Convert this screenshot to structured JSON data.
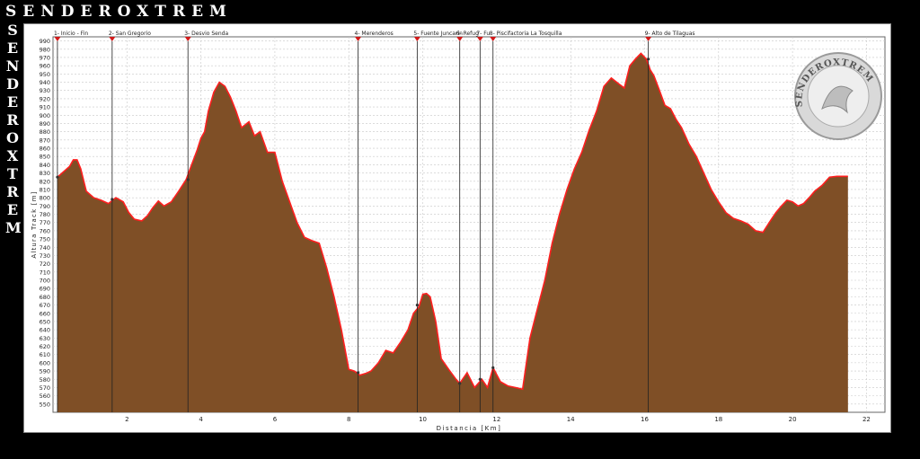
{
  "brand": {
    "title": "SENDEROXTREM",
    "vertical": [
      "S",
      "E",
      "N",
      "D",
      "E",
      "R",
      "O",
      "X",
      "T",
      "R",
      "E",
      "M"
    ],
    "logo_text": "SENDEROXTREM"
  },
  "colors": {
    "fill": "#7f4f26",
    "line": "#ff1f1f",
    "waypoint_line": "#222222",
    "waypoint_marker": "#d11a1a",
    "grid": "#c8c8c8",
    "panel": "#ffffff",
    "background": "#000000"
  },
  "chart_data": {
    "type": "area",
    "title": "",
    "xlabel": "Distancia [Km]",
    "ylabel": "Altura Track [m]",
    "xlim": [
      0,
      22.5
    ],
    "ylim": [
      540,
      995
    ],
    "x_ticks": [
      2,
      4,
      6,
      8,
      10,
      12,
      14,
      16,
      18,
      20,
      22
    ],
    "y_ticks": [
      550,
      560,
      570,
      580,
      590,
      600,
      610,
      620,
      630,
      640,
      650,
      660,
      670,
      680,
      690,
      700,
      710,
      720,
      730,
      740,
      750,
      760,
      770,
      780,
      790,
      800,
      810,
      820,
      830,
      840,
      850,
      860,
      870,
      880,
      890,
      900,
      910,
      920,
      930,
      940,
      950,
      960,
      970,
      980,
      990
    ],
    "grid": true,
    "legend": "none",
    "series": [
      {
        "x": [
          0.12,
          0.3,
          0.45,
          0.55,
          0.65,
          0.75,
          0.9,
          1.1,
          1.3,
          1.5,
          1.7,
          1.9,
          2.05,
          2.2,
          2.4,
          2.55,
          2.7,
          2.85,
          3.0,
          3.2,
          3.4,
          3.6,
          3.75,
          3.9,
          4.0,
          4.1,
          4.2,
          4.35,
          4.5,
          4.65,
          4.8,
          4.95,
          5.1,
          5.3,
          5.45,
          5.6,
          5.8,
          6.0,
          6.2,
          6.4,
          6.6,
          6.8,
          7.0,
          7.2,
          7.4,
          7.6,
          7.8,
          8.0,
          8.15,
          8.3,
          8.45,
          8.6,
          8.8,
          9.0,
          9.2,
          9.4,
          9.6,
          9.75,
          9.9,
          10.0,
          10.1,
          10.2,
          10.35,
          10.5,
          10.7,
          10.9,
          11.0,
          11.2,
          11.4,
          11.6,
          11.75,
          11.9,
          12.1,
          12.3,
          12.5,
          12.7,
          12.9,
          13.1,
          13.3,
          13.5,
          13.7,
          13.9,
          14.1,
          14.3,
          14.5,
          14.7,
          14.9,
          15.1,
          15.3,
          15.45,
          15.6,
          15.75,
          15.9,
          16.05,
          16.15,
          16.25,
          16.4,
          16.55,
          16.7,
          16.85,
          17.0,
          17.2,
          17.4,
          17.6,
          17.8,
          18.0,
          18.2,
          18.4,
          18.6,
          18.8,
          19.0,
          19.2,
          19.4,
          19.55,
          19.7,
          19.85,
          20.0,
          20.15,
          20.3,
          20.45,
          20.6,
          20.8,
          21.0,
          21.2,
          21.4,
          21.5
        ],
        "y": [
          825,
          832,
          838,
          846,
          846,
          835,
          808,
          800,
          797,
          793,
          800,
          795,
          782,
          774,
          772,
          778,
          788,
          796,
          790,
          795,
          808,
          822,
          840,
          858,
          872,
          880,
          905,
          928,
          940,
          935,
          922,
          905,
          885,
          892,
          875,
          880,
          855,
          855,
          820,
          795,
          770,
          752,
          748,
          745,
          715,
          680,
          640,
          592,
          590,
          585,
          587,
          590,
          600,
          615,
          612,
          625,
          640,
          660,
          668,
          683,
          684,
          680,
          650,
          605,
          592,
          580,
          575,
          588,
          570,
          580,
          570,
          594,
          577,
          572,
          570,
          568,
          630,
          665,
          700,
          745,
          780,
          810,
          835,
          855,
          882,
          905,
          935,
          945,
          938,
          933,
          960,
          968,
          975,
          968,
          955,
          948,
          930,
          912,
          908,
          895,
          885,
          865,
          850,
          830,
          810,
          795,
          782,
          775,
          772,
          768,
          760,
          758,
          772,
          782,
          790,
          797,
          795,
          790,
          793,
          800,
          808,
          815,
          825,
          826,
          826,
          826
        ],
        "name": ""
      }
    ],
    "waypoints": [
      {
        "label": "1- Inicio - Fin",
        "km": 0.12,
        "elev": 825
      },
      {
        "label": "2- San Gregorio",
        "km": 1.6,
        "elev": 798
      },
      {
        "label": "3- Desvio Senda",
        "km": 3.65,
        "elev": 822
      },
      {
        "label": "4- Merenderos",
        "km": 8.25,
        "elev": 588
      },
      {
        "label": "5- Fuente Juncarin",
        "km": 9.85,
        "elev": 670
      },
      {
        "label": "6- Refug",
        "km": 11.0,
        "elev": 575
      },
      {
        "label": "7- Fu",
        "km": 11.55,
        "elev": 580
      },
      {
        "label": "8- Piscifactoria La Tosquilla",
        "km": 11.9,
        "elev": 594
      },
      {
        "label": "9- Alto de Tilaguas",
        "km": 16.1,
        "elev": 968
      }
    ]
  }
}
